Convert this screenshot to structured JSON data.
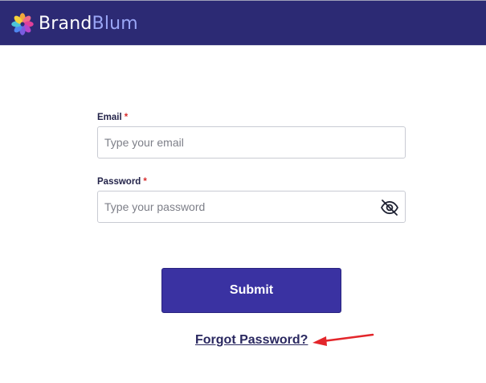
{
  "header": {
    "brand_part1": "Brand",
    "brand_part2": "Blum",
    "logo_icon": "flower-petals-icon"
  },
  "form": {
    "email": {
      "label": "Email",
      "required_mark": "*",
      "placeholder": "Type your email",
      "value": ""
    },
    "password": {
      "label": "Password",
      "required_mark": "*",
      "placeholder": "Type your password",
      "value": "",
      "toggle_icon": "eye-slash-icon"
    },
    "submit_label": "Submit",
    "forgot_label": "Forgot Password?"
  },
  "annotation": {
    "arrow_color": "#e3262b"
  },
  "colors": {
    "header_bg": "#2c2a74",
    "button_bg": "#3a32a2",
    "brand_accent": "#9aa6f6",
    "required": "#d92c2c"
  }
}
